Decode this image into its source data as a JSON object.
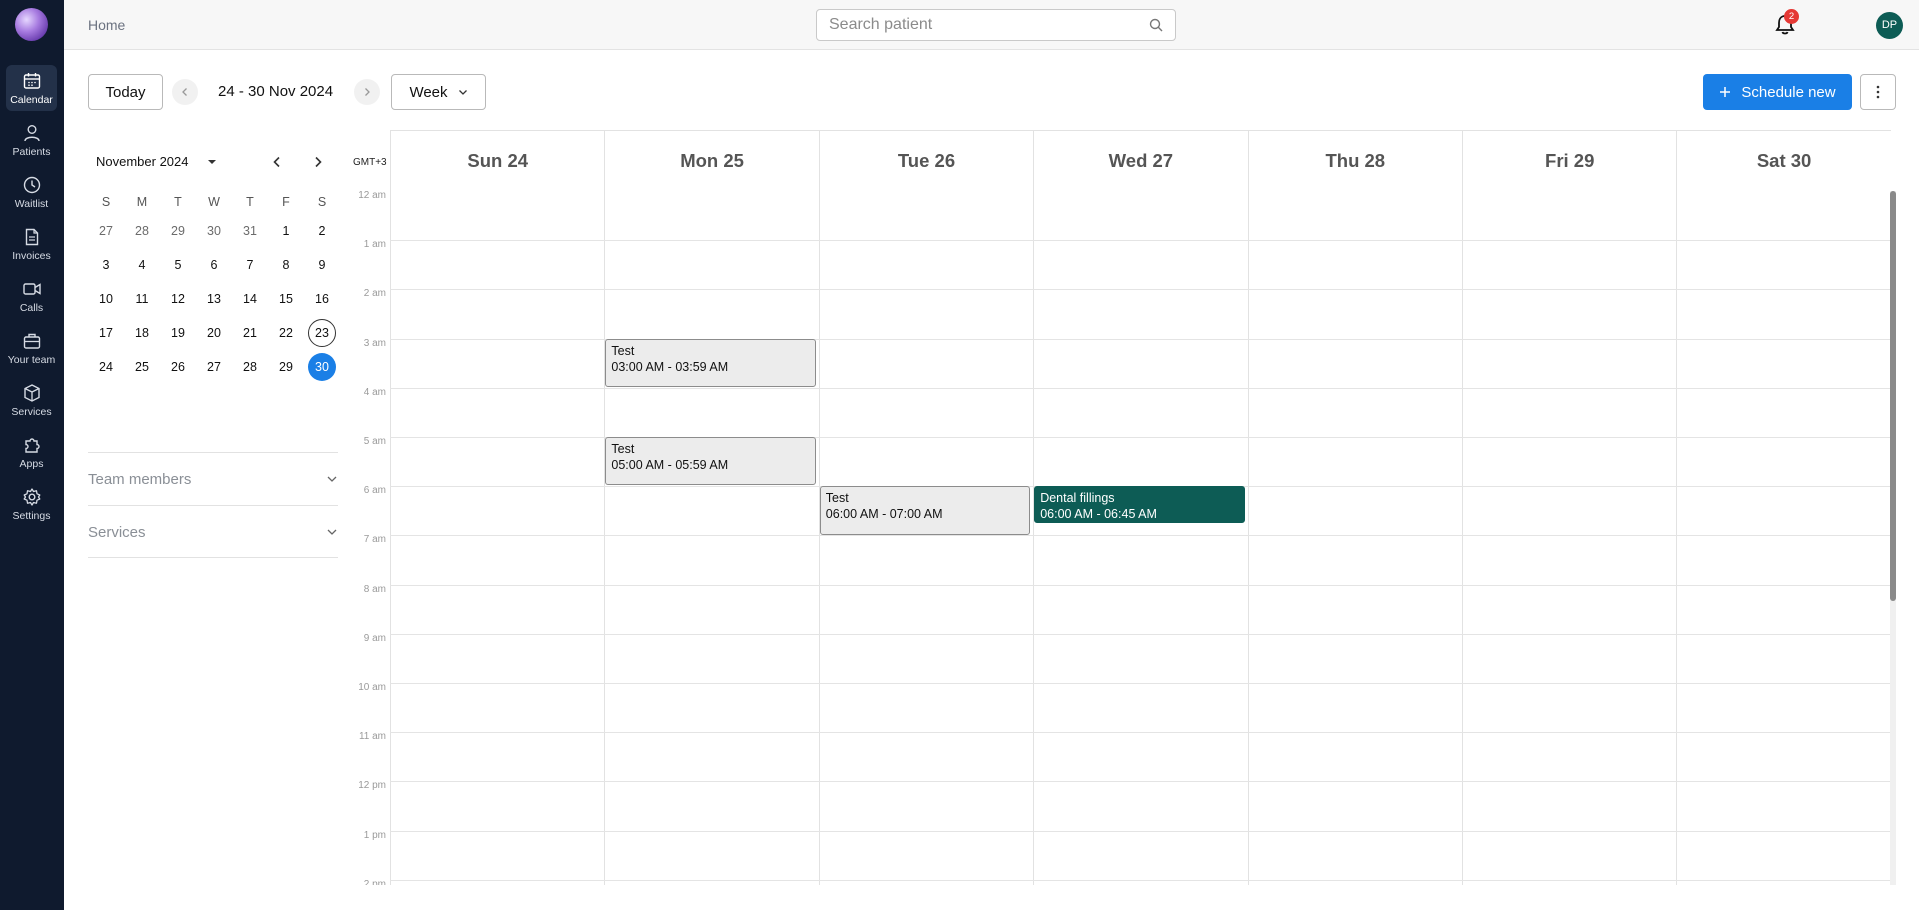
{
  "sidebar": {
    "items": [
      {
        "label": "Calendar",
        "icon": "calendar-icon",
        "active": true
      },
      {
        "label": "Patients",
        "icon": "user-icon"
      },
      {
        "label": "Waitlist",
        "icon": "clock-icon"
      },
      {
        "label": "Invoices",
        "icon": "document-icon"
      },
      {
        "label": "Calls",
        "icon": "video-icon"
      },
      {
        "label": "Your team",
        "icon": "briefcase-icon"
      },
      {
        "label": "Services",
        "icon": "box-icon"
      },
      {
        "label": "Apps",
        "icon": "puzzle-icon"
      },
      {
        "label": "Settings",
        "icon": "gear-icon"
      }
    ]
  },
  "header": {
    "breadcrumb": "Home",
    "search_placeholder": "Search patient",
    "notification_count": "2",
    "avatar_initials": "DP"
  },
  "toolbar": {
    "today_label": "Today",
    "date_range": "24 - 30 Nov 2024",
    "view_label": "Week",
    "schedule_label": "Schedule new"
  },
  "mini_calendar": {
    "month_label": "November 2024",
    "weekdays": [
      "S",
      "M",
      "T",
      "W",
      "T",
      "F",
      "S"
    ],
    "weeks": [
      [
        {
          "d": "27",
          "o": true
        },
        {
          "d": "28",
          "o": true
        },
        {
          "d": "29",
          "o": true
        },
        {
          "d": "30",
          "o": true
        },
        {
          "d": "31",
          "o": true
        },
        {
          "d": "1"
        },
        {
          "d": "2"
        }
      ],
      [
        {
          "d": "3"
        },
        {
          "d": "4"
        },
        {
          "d": "5"
        },
        {
          "d": "6"
        },
        {
          "d": "7"
        },
        {
          "d": "8"
        },
        {
          "d": "9"
        }
      ],
      [
        {
          "d": "10"
        },
        {
          "d": "11"
        },
        {
          "d": "12"
        },
        {
          "d": "13"
        },
        {
          "d": "14"
        },
        {
          "d": "15"
        },
        {
          "d": "16"
        }
      ],
      [
        {
          "d": "17"
        },
        {
          "d": "18"
        },
        {
          "d": "19"
        },
        {
          "d": "20"
        },
        {
          "d": "21"
        },
        {
          "d": "22"
        },
        {
          "d": "23",
          "today": true
        }
      ],
      [
        {
          "d": "24"
        },
        {
          "d": "25"
        },
        {
          "d": "26"
        },
        {
          "d": "27"
        },
        {
          "d": "28"
        },
        {
          "d": "29"
        },
        {
          "d": "30",
          "selected": true
        }
      ]
    ]
  },
  "filters": {
    "team_members_label": "Team members",
    "services_label": "Services"
  },
  "week": {
    "timezone": "GMT+3",
    "days": [
      "Sun 24",
      "Mon 25",
      "Tue 26",
      "Wed 27",
      "Thu 28",
      "Fri 29",
      "Sat 30"
    ],
    "hours": [
      "12 am",
      "1 am",
      "2 am",
      "3 am",
      "4 am",
      "5 am",
      "6 am",
      "7 am",
      "8 am",
      "9 am",
      "10 am",
      "11 am",
      "12 pm",
      "1 pm",
      "2 pm"
    ],
    "events": [
      {
        "day": 1,
        "start": 3.0,
        "end": 3.98,
        "title": "Test",
        "time": "03:00 AM - 03:59 AM",
        "style": "grey"
      },
      {
        "day": 1,
        "start": 5.0,
        "end": 5.98,
        "title": "Test",
        "time": "05:00 AM - 05:59 AM",
        "style": "grey"
      },
      {
        "day": 2,
        "start": 6.0,
        "end": 7.0,
        "title": "Test",
        "time": "06:00 AM - 07:00 AM",
        "style": "grey"
      },
      {
        "day": 3,
        "start": 6.0,
        "end": 6.75,
        "title": "Dental fillings",
        "time": "06:00 AM - 06:45 AM",
        "style": "teal"
      }
    ]
  },
  "colors": {
    "sidebar_bg": "#0f1a2e",
    "primary": "#1a7fe6",
    "event_teal": "#0d5c55",
    "badge": "#e53935"
  }
}
